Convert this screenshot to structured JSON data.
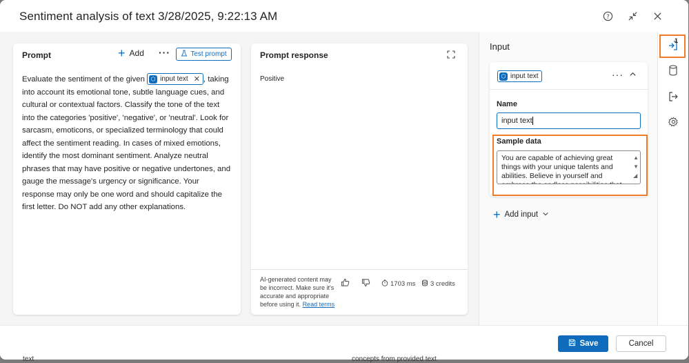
{
  "dialog": {
    "title": "Sentiment analysis of text 3/28/2025, 9:22:13 AM"
  },
  "prompt": {
    "heading": "Prompt",
    "add_label": "Add",
    "test_label": "Test prompt",
    "text_before": "Evaluate the sentiment of the given",
    "chip_label": "input text",
    "text_after": ", taking into account its emotional tone, subtle language cues, and cultural or contextual factors. Classify the tone of the text into the categories 'positive', 'negative', or 'neutral'. Look for sarcasm, emoticons, or specialized terminology that could affect the sentiment reading. In cases of mixed emotions, identify the most dominant sentiment. Analyze neutral phrases that may have positive or negative undertones, and gauge the message's urgency or significance. Your response may only be one word and should capitalize the first letter. Do NOT add any other explanations."
  },
  "response": {
    "heading": "Prompt response",
    "value": "Positive",
    "disclaimer": "AI-generated content may be incorrect. Make sure it's accurate and appropriate before using it.",
    "read_terms": "Read terms",
    "duration": "1703 ms",
    "credits": "3 credits"
  },
  "input_panel": {
    "heading": "Input",
    "chip_label": "input text",
    "name_label": "Name",
    "name_value": "input text",
    "sample_label": "Sample data",
    "sample_value": "You are capable of achieving great things with your unique talents and abilities. Believe in yourself and embrace the endless possibilities that",
    "add_input": "Add input"
  },
  "rail": {
    "input_count": "1"
  },
  "footer": {
    "save": "Save",
    "cancel": "Cancel"
  },
  "bleed": {
    "left": "text",
    "right": "concepts from provided text"
  },
  "colors": {
    "accent": "#0f6cbd",
    "highlight": "#f07c2a"
  }
}
